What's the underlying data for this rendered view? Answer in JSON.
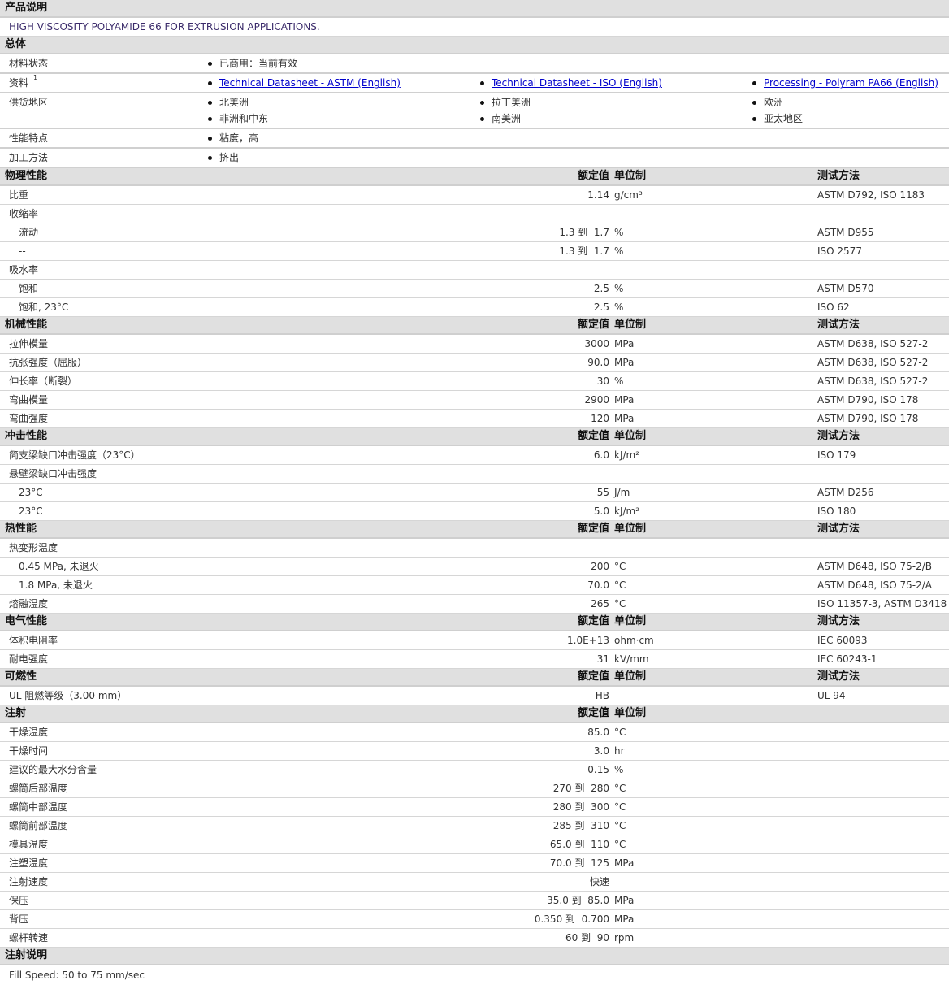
{
  "product_description": {
    "title": "产品说明",
    "text": "HIGH VISCOSITY POLYAMIDE 66 FOR EXTRUSION APPLICATIONS."
  },
  "general": {
    "title": "总体",
    "rows": [
      {
        "label": "材料状态",
        "items": [
          [
            "已商用：当前有效"
          ]
        ]
      },
      {
        "label": "资料",
        "sup": "1",
        "links": true,
        "items": [
          [
            "Technical Datasheet - ASTM (English)"
          ],
          [
            "Technical Datasheet - ISO (English)"
          ],
          [
            "Processing - Polyram PA66 (English)"
          ]
        ]
      },
      {
        "label": "供货地区",
        "items": [
          [
            "北美洲",
            "非洲和中东"
          ],
          [
            "拉丁美洲",
            "南美洲"
          ],
          [
            "欧洲",
            "亚太地区"
          ]
        ]
      },
      {
        "label": "性能特点",
        "items": [
          [
            "粘度，高"
          ]
        ]
      },
      {
        "label": "加工方法",
        "items": [
          [
            "挤出"
          ]
        ]
      }
    ]
  },
  "sections": [
    {
      "title": "物理性能",
      "col_value": "额定值",
      "col_unit": "单位制",
      "col_method": "测试方法",
      "rows": [
        {
          "label": "比重",
          "value": "1.14",
          "unit": "g/cm³",
          "method": "ASTM D792, ISO 1183"
        },
        {
          "label": "收缩率"
        },
        {
          "label": "流动",
          "indent": true,
          "value": "1.3 到  1.7",
          "unit": "%",
          "method": "ASTM D955"
        },
        {
          "label": "--",
          "indent": true,
          "value": "1.3 到  1.7",
          "unit": "%",
          "method": "ISO 2577"
        },
        {
          "label": "吸水率"
        },
        {
          "label": "饱和",
          "indent": true,
          "value": "2.5",
          "unit": "%",
          "method": "ASTM D570"
        },
        {
          "label": "饱和, 23°C",
          "indent": true,
          "value": "2.5",
          "unit": "%",
          "method": "ISO 62"
        }
      ]
    },
    {
      "title": "机械性能",
      "col_value": "额定值",
      "col_unit": "单位制",
      "col_method": "测试方法",
      "rows": [
        {
          "label": "拉伸模量",
          "value": "3000",
          "unit": "MPa",
          "method": "ASTM D638, ISO 527-2"
        },
        {
          "label": "抗张强度（屈服）",
          "value": "90.0",
          "unit": "MPa",
          "method": "ASTM D638, ISO 527-2"
        },
        {
          "label": "伸长率（断裂）",
          "value": "30",
          "unit": "%",
          "method": "ASTM D638, ISO 527-2"
        },
        {
          "label": "弯曲模量",
          "value": "2900",
          "unit": "MPa",
          "method": "ASTM D790, ISO 178"
        },
        {
          "label": "弯曲强度",
          "value": "120",
          "unit": "MPa",
          "method": "ASTM D790, ISO 178"
        }
      ]
    },
    {
      "title": "冲击性能",
      "col_value": "额定值",
      "col_unit": "单位制",
      "col_method": "测试方法",
      "rows": [
        {
          "label": "简支梁缺口冲击强度（23°C）",
          "value": "6.0",
          "unit": "kJ/m²",
          "method": "ISO 179"
        },
        {
          "label": "悬壁梁缺口冲击强度"
        },
        {
          "label": "23°C",
          "indent": true,
          "value": "55",
          "unit": "J/m",
          "method": "ASTM D256"
        },
        {
          "label": "23°C",
          "indent": true,
          "value": "5.0",
          "unit": "kJ/m²",
          "method": "ISO 180"
        }
      ]
    },
    {
      "title": "热性能",
      "col_value": "额定值",
      "col_unit": "单位制",
      "col_method": "测试方法",
      "rows": [
        {
          "label": "热变形温度"
        },
        {
          "label": "0.45 MPa, 未退火",
          "indent": true,
          "value": "200",
          "unit": "°C",
          "method": "ASTM D648, ISO 75-2/B"
        },
        {
          "label": "1.8 MPa, 未退火",
          "indent": true,
          "value": "70.0",
          "unit": "°C",
          "method": "ASTM D648, ISO 75-2/A"
        },
        {
          "label": "熔融温度",
          "value": "265",
          "unit": "°C",
          "method": "ISO 11357-3, ASTM D3418"
        }
      ]
    },
    {
      "title": "电气性能",
      "col_value": "额定值",
      "col_unit": "单位制",
      "col_method": "测试方法",
      "rows": [
        {
          "label": "体积电阻率",
          "value": "1.0E+13",
          "unit": "ohm·cm",
          "method": "IEC 60093"
        },
        {
          "label": "耐电强度",
          "value": "31",
          "unit": "kV/mm",
          "method": "IEC 60243-1"
        }
      ]
    },
    {
      "title": "可燃性",
      "col_value": "额定值",
      "col_unit": "单位制",
      "col_method": "测试方法",
      "rows": [
        {
          "label": "UL 阻燃等级（3.00 mm）",
          "value": "HB",
          "method": "UL 94"
        }
      ]
    },
    {
      "title": "注射",
      "col_value": "额定值",
      "col_unit": "单位制",
      "rows": [
        {
          "label": "干燥温度",
          "value": "85.0",
          "unit": "°C"
        },
        {
          "label": "干燥时间",
          "value": "3.0",
          "unit": "hr"
        },
        {
          "label": "建议的最大水分含量",
          "value": "0.15",
          "unit": "%"
        },
        {
          "label": "螺筒后部温度",
          "value": "270 到  280",
          "unit": "°C"
        },
        {
          "label": "螺筒中部温度",
          "value": "280 到  300",
          "unit": "°C"
        },
        {
          "label": "螺筒前部温度",
          "value": "285 到  310",
          "unit": "°C"
        },
        {
          "label": "模具温度",
          "value": "65.0 到  110",
          "unit": "°C"
        },
        {
          "label": "注塑温度",
          "value": "70.0 到  125",
          "unit": "MPa"
        },
        {
          "label": "注射速度",
          "value": "快速"
        },
        {
          "label": "保压",
          "value": "35.0 到  85.0",
          "unit": "MPa"
        },
        {
          "label": "背压",
          "value": "0.350 到  0.700",
          "unit": "MPa"
        },
        {
          "label": "螺杆转速",
          "value": "60 到  90",
          "unit": "rpm"
        }
      ]
    }
  ],
  "injection_notes": {
    "title": "注射说明",
    "text": "Fill Speed: 50 to 75 mm/sec"
  }
}
